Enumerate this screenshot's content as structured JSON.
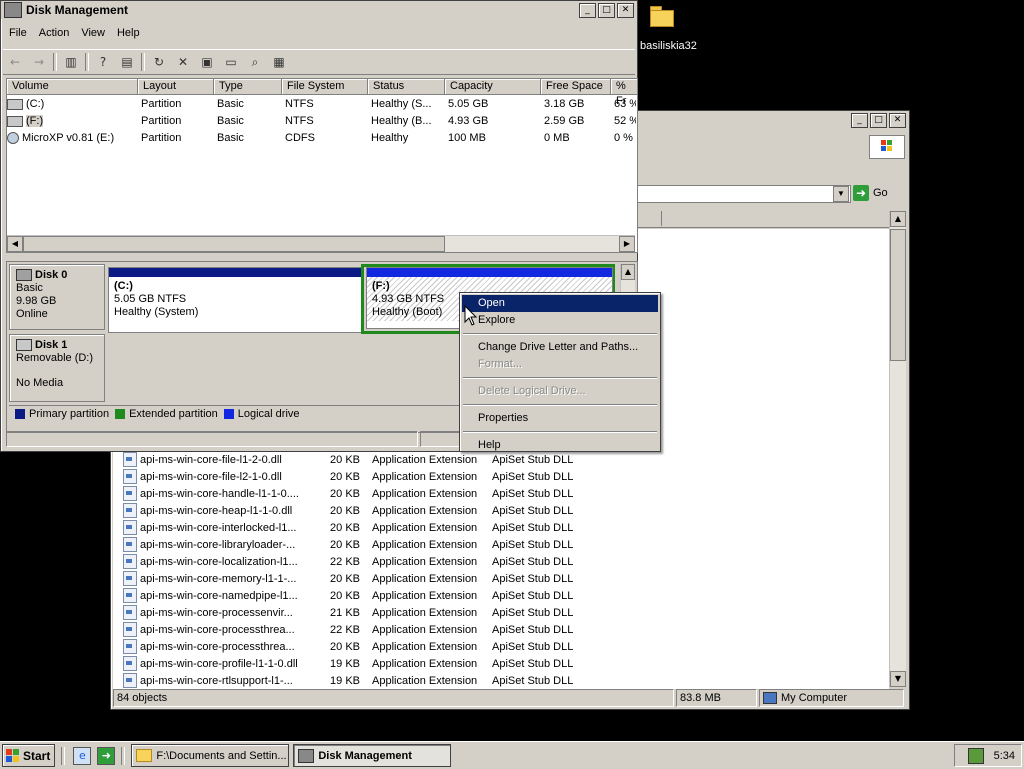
{
  "desktop": {
    "icon_label": "basiliskia32"
  },
  "explorer": {
    "address_go": "Go",
    "files": [
      {
        "name": "api-ms-win-core-file-l1-2-0.dll",
        "size": "20 KB",
        "type": "Application Extension",
        "desc": "ApiSet Stub DLL"
      },
      {
        "name": "api-ms-win-core-file-l2-1-0.dll",
        "size": "20 KB",
        "type": "Application Extension",
        "desc": "ApiSet Stub DLL"
      },
      {
        "name": "api-ms-win-core-handle-l1-1-0....",
        "size": "20 KB",
        "type": "Application Extension",
        "desc": "ApiSet Stub DLL"
      },
      {
        "name": "api-ms-win-core-heap-l1-1-0.dll",
        "size": "20 KB",
        "type": "Application Extension",
        "desc": "ApiSet Stub DLL"
      },
      {
        "name": "api-ms-win-core-interlocked-l1...",
        "size": "20 KB",
        "type": "Application Extension",
        "desc": "ApiSet Stub DLL"
      },
      {
        "name": "api-ms-win-core-libraryloader-...",
        "size": "20 KB",
        "type": "Application Extension",
        "desc": "ApiSet Stub DLL"
      },
      {
        "name": "api-ms-win-core-localization-l1...",
        "size": "22 KB",
        "type": "Application Extension",
        "desc": "ApiSet Stub DLL"
      },
      {
        "name": "api-ms-win-core-memory-l1-1-...",
        "size": "20 KB",
        "type": "Application Extension",
        "desc": "ApiSet Stub DLL"
      },
      {
        "name": "api-ms-win-core-namedpipe-l1...",
        "size": "20 KB",
        "type": "Application Extension",
        "desc": "ApiSet Stub DLL"
      },
      {
        "name": "api-ms-win-core-processenvir...",
        "size": "21 KB",
        "type": "Application Extension",
        "desc": "ApiSet Stub DLL"
      },
      {
        "name": "api-ms-win-core-processthrea...",
        "size": "22 KB",
        "type": "Application Extension",
        "desc": "ApiSet Stub DLL"
      },
      {
        "name": "api-ms-win-core-processthrea...",
        "size": "20 KB",
        "type": "Application Extension",
        "desc": "ApiSet Stub DLL"
      },
      {
        "name": "api-ms-win-core-profile-l1-1-0.dll",
        "size": "19 KB",
        "type": "Application Extension",
        "desc": "ApiSet Stub DLL"
      },
      {
        "name": "api-ms-win-core-rtlsupport-l1-...",
        "size": "19 KB",
        "type": "Application Extension",
        "desc": "ApiSet Stub DLL"
      }
    ],
    "status_objects": "84 objects",
    "status_size": "83.8 MB",
    "status_location": "My Computer"
  },
  "disk_mgmt": {
    "title": "Disk Management",
    "menu": [
      "File",
      "Action",
      "View",
      "Help"
    ],
    "columns": [
      "Volume",
      "Layout",
      "Type",
      "File System",
      "Status",
      "Capacity",
      "Free Space",
      "% Fr"
    ],
    "volumes": [
      {
        "volume": "(C:)",
        "layout": "Partition",
        "type": "Basic",
        "fs": "NTFS",
        "status": "Healthy (S...",
        "capacity": "5.05 GB",
        "free": "3.18 GB",
        "pct": "63 %"
      },
      {
        "volume": "(F:)",
        "layout": "Partition",
        "type": "Basic",
        "fs": "NTFS",
        "status": "Healthy (B...",
        "capacity": "4.93 GB",
        "free": "2.59 GB",
        "pct": "52 %"
      },
      {
        "volume": "MicroXP v0.81 (E:)",
        "layout": "Partition",
        "type": "Basic",
        "fs": "CDFS",
        "status": "Healthy",
        "capacity": "100 MB",
        "free": "0 MB",
        "pct": "0 %"
      }
    ],
    "disk0": {
      "name": "Disk 0",
      "kind": "Basic",
      "size": "9.98 GB",
      "state": "Online"
    },
    "disk0_c": {
      "label": "(C:)",
      "detail": "5.05 GB NTFS",
      "status": "Healthy (System)"
    },
    "disk0_f": {
      "label": "(F:)",
      "detail": "4.93 GB NTFS",
      "status": "Healthy (Boot)"
    },
    "disk1": {
      "name": "Disk 1",
      "kind": "Removable (D:)",
      "state": "No Media"
    },
    "legend": [
      "Primary partition",
      "Extended partition",
      "Logical drive"
    ],
    "colors": {
      "primary": "#0c1a86",
      "extended": "#1e8a1e",
      "logical": "#1228e0"
    }
  },
  "context_menu": {
    "open": "Open",
    "explore": "Explore",
    "change": "Change Drive Letter and Paths...",
    "format": "Format...",
    "delete": "Delete Logical Drive...",
    "properties": "Properties",
    "help": "Help"
  },
  "taskbar": {
    "start": "Start",
    "task1": "F:\\Documents and Settin...",
    "task2": "Disk Management",
    "clock": "5:34"
  }
}
